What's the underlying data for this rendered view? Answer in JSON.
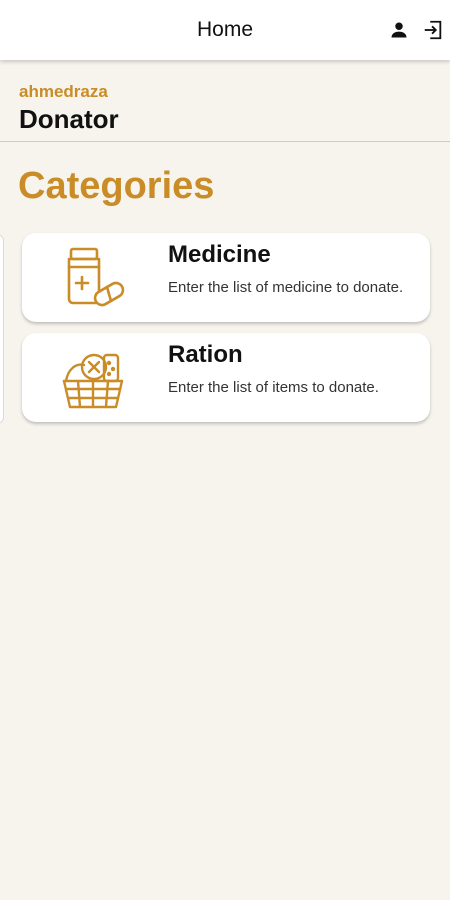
{
  "appbar": {
    "title": "Home",
    "actions": [
      {
        "icon": "person-icon"
      },
      {
        "icon": "logout-icon"
      }
    ]
  },
  "user": {
    "username": "ahmedraza",
    "role": "Donator"
  },
  "section": {
    "title": "Categories"
  },
  "categories": [
    {
      "title": "Medicine",
      "description": "Enter the list of medicine to donate.",
      "icon": "medicine-bottle-icon"
    },
    {
      "title": "Ration",
      "description": "Enter the list of items to donate.",
      "icon": "ration-basket-icon"
    }
  ],
  "colors": {
    "accent": "#c98c26",
    "background": "#f7f4ee",
    "card": "#ffffff"
  }
}
